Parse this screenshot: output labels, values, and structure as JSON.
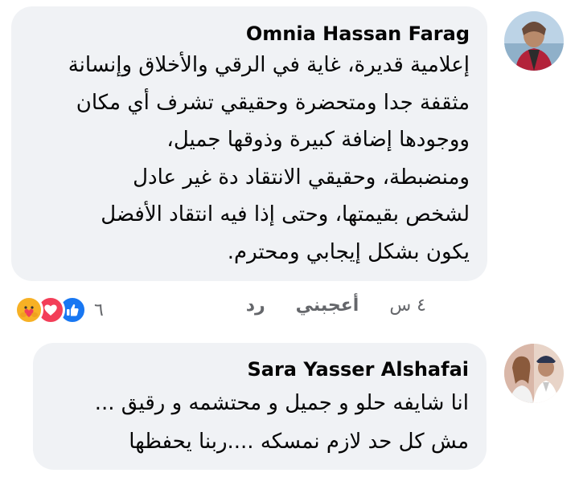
{
  "comments": [
    {
      "author": "Omnia Hassan Farag",
      "lines": [
        "إعلامية قديرة، غاية في الرقي والأخلاق وإنسانة",
        "مثقفة جدا ومتحضرة وحقيقي تشرف أي مكان",
        "ووجودها إضافة كبيرة وذوقها جميل،",
        "ومنضبطة، وحقيقي الانتقاد دة غير عادل",
        "لشخص بقيمتها، وحتى إذا فيه انتقاد الأفضل",
        "يكون بشكل إيجابي ومحترم."
      ],
      "time": "٤ س",
      "like_label": "أعجبني",
      "reply_label": "رد",
      "reaction_count": "٦",
      "reaction_icons": [
        "care-icon",
        "love-icon",
        "like-icon"
      ]
    },
    {
      "author": "Sara Yasser Alshafai",
      "lines": [
        "انا شايفه حلو و جميل و محتشمه و رقيق ...",
        "مش كل حد لازم نمسكه ....ربنا يحفظها"
      ]
    }
  ],
  "colors": {
    "bubble": "#f0f2f5",
    "meta_text": "#65676b",
    "like_blue": "#1877f2",
    "love_red": "#f33e58",
    "care_yellow": "#f7b125"
  }
}
